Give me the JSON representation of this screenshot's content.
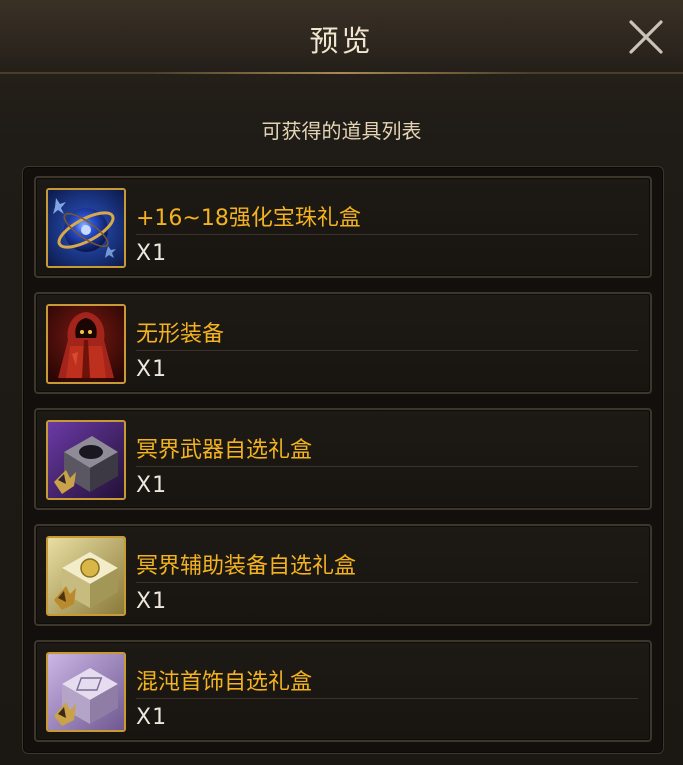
{
  "dialog": {
    "title": "预览",
    "subtitle": "可获得的道具列表"
  },
  "items": [
    {
      "name": "+16~18强化宝珠礼盒",
      "qty": "X1",
      "icon": "blue-orb-icon"
    },
    {
      "name": "无形装备",
      "qty": "X1",
      "icon": "red-hooded-robe-icon"
    },
    {
      "name": "冥界武器自选礼盒",
      "qty": "X1",
      "icon": "purple-box-icon"
    },
    {
      "name": "冥界辅助装备自选礼盒",
      "qty": "X1",
      "icon": "gold-box-icon"
    },
    {
      "name": "混沌首饰自选礼盒",
      "qty": "X1",
      "icon": "lilac-box-icon"
    }
  ],
  "colors": {
    "item_name": "#f3b21f",
    "icon_border": "#c79a36",
    "title_text": "#f1e6cf"
  }
}
